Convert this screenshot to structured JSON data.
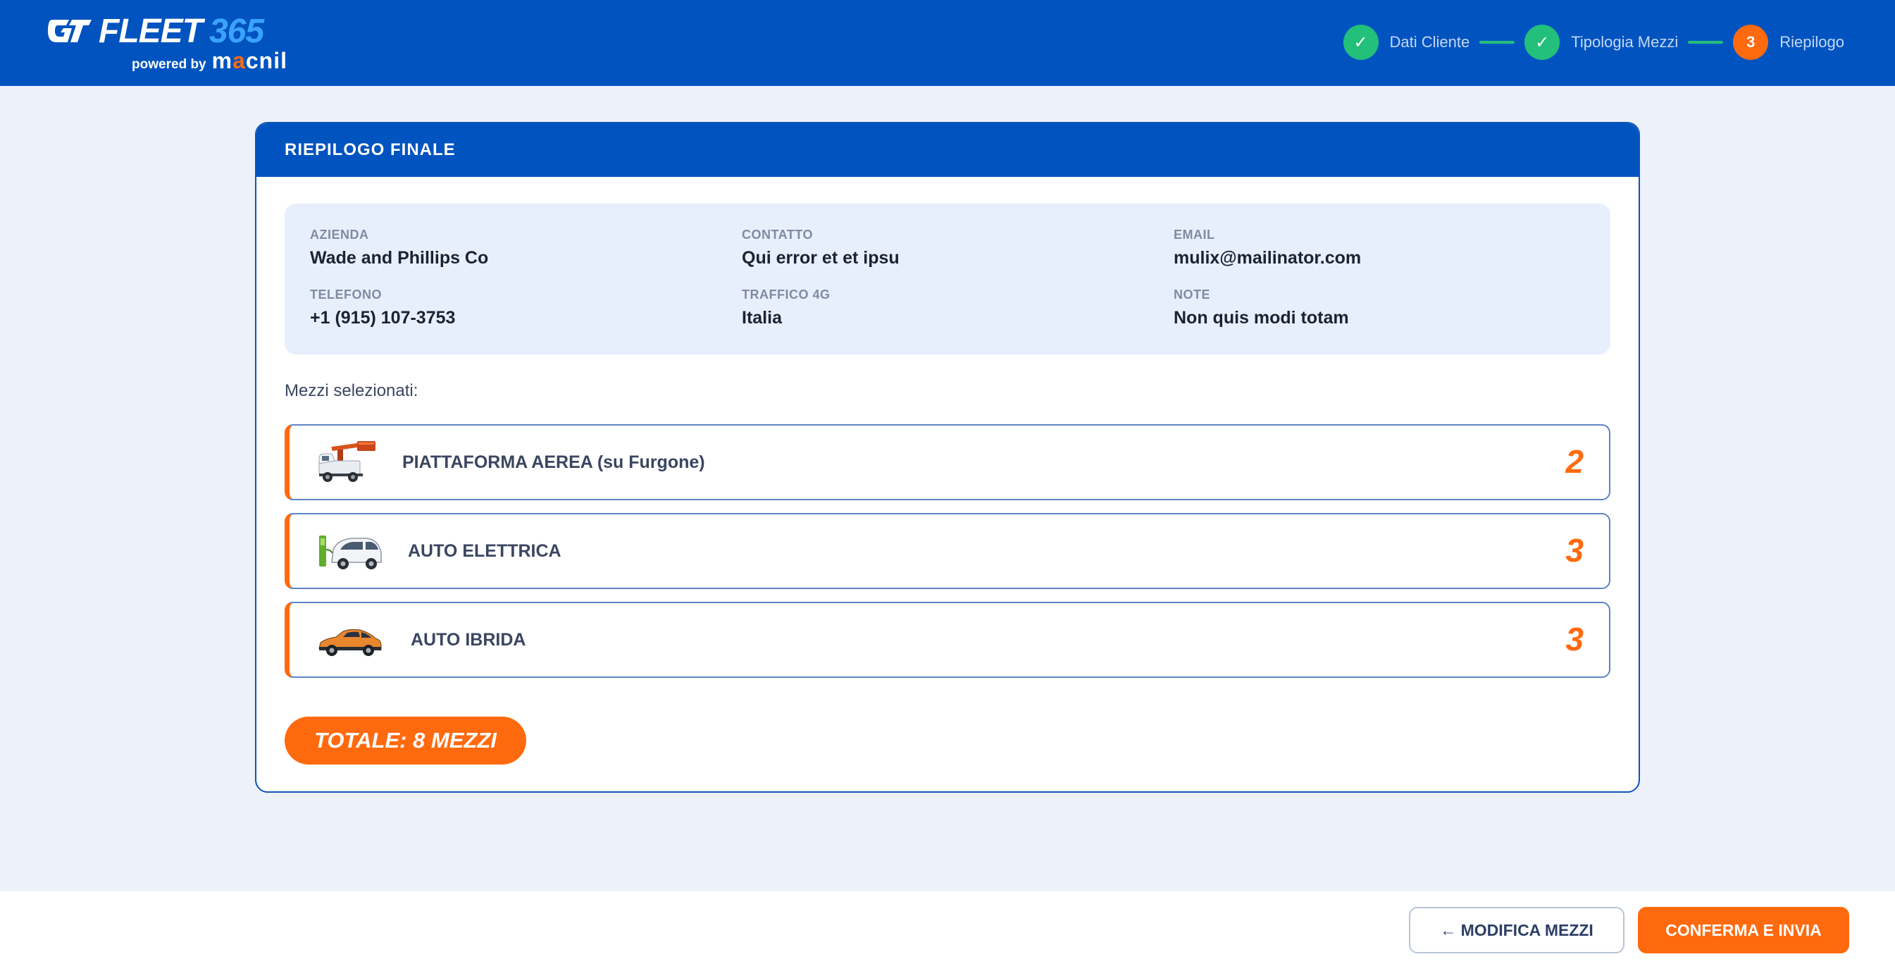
{
  "header": {
    "logo": {
      "brand": "FLEET",
      "number": "365",
      "powered_by": "powered by",
      "company": "macnil"
    },
    "steps": [
      {
        "label": "Dati Cliente",
        "status": "done",
        "icon": "check-icon",
        "marker": "✓"
      },
      {
        "label": "Tipologia Mezzi",
        "status": "done",
        "icon": "check-icon",
        "marker": "✓"
      },
      {
        "label": "Riepilogo",
        "status": "active",
        "marker": "3"
      }
    ]
  },
  "summary": {
    "title": "RIEPILOGO FINALE",
    "client": [
      {
        "label": "AZIENDA",
        "value": "Wade and Phillips Co"
      },
      {
        "label": "CONTATTO",
        "value": "Qui error et et ipsu"
      },
      {
        "label": "EMAIL",
        "value": "mulix@mailinator.com"
      },
      {
        "label": "TELEFONO",
        "value": "+1 (915) 107-3753"
      },
      {
        "label": "TRAFFICO 4G",
        "value": "Italia"
      },
      {
        "label": "NOTE",
        "value": "Non quis modi totam"
      }
    ],
    "vehicles_label": "Mezzi selezionati:",
    "vehicles": [
      {
        "name": "PIATTAFORMA AEREA (su Furgone)",
        "count": "2",
        "icon": "aerial-platform-van-image"
      },
      {
        "name": "AUTO ELETTRICA",
        "count": "3",
        "icon": "electric-car-image"
      },
      {
        "name": "AUTO IBRIDA",
        "count": "3",
        "icon": "hybrid-car-image"
      }
    ],
    "total": "TOTALE: 8 MEZZI"
  },
  "footer": {
    "back_label": "← MODIFICA MEZZI",
    "confirm_label": "CONFERMA E INVIA"
  },
  "colors": {
    "primary": "#0153c0",
    "accent": "#ff6a0e",
    "success": "#22c07a",
    "background": "#edf1fa"
  }
}
